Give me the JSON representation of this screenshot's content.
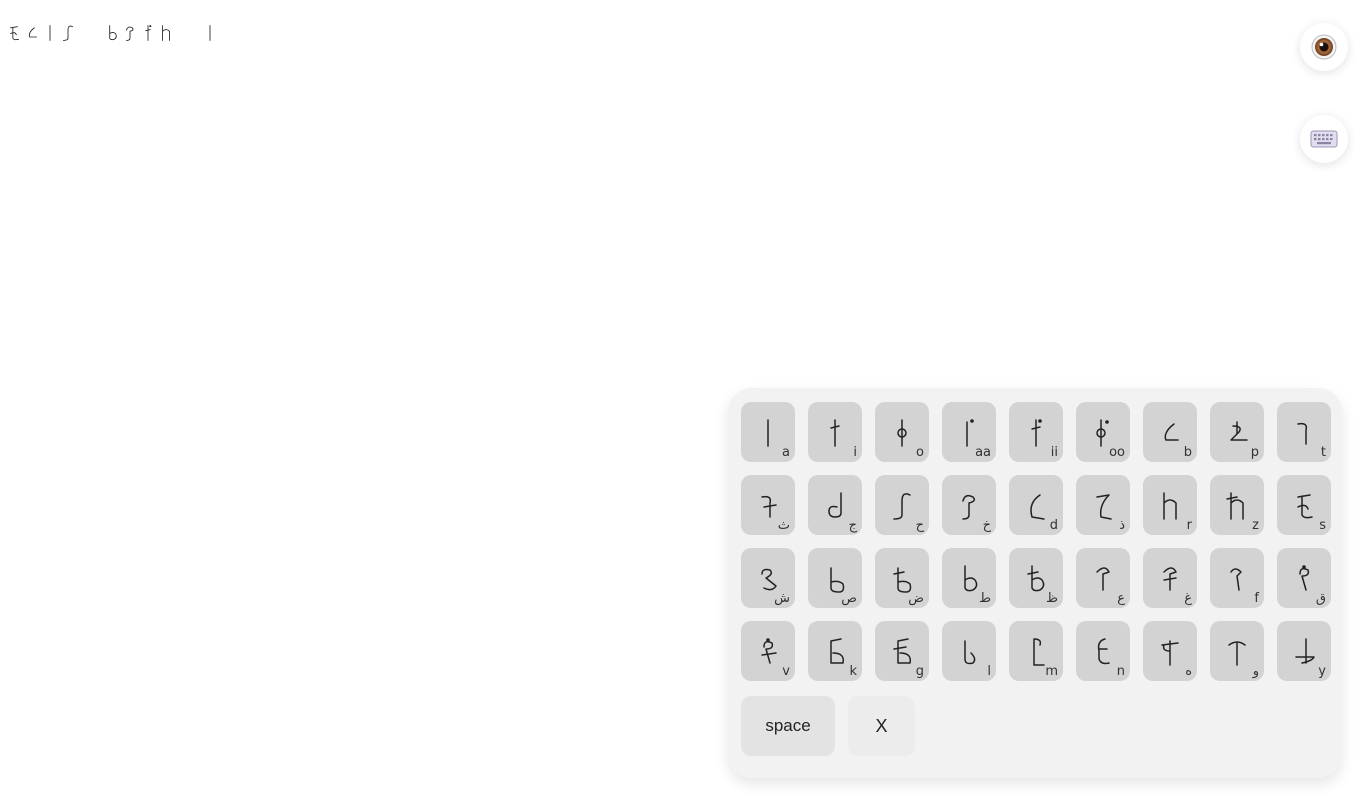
{
  "output": {
    "words": [
      {
        "glyphs": [
          "s",
          "b",
          "a",
          "ha"
        ]
      },
      {
        "glyphs": [
          "ta",
          "kha",
          "ii",
          "r"
        ]
      },
      {
        "glyphs": [
          "a"
        ]
      }
    ]
  },
  "buttons": {
    "eye_icon": "eye-icon",
    "keyboard_icon": "keyboard-icon"
  },
  "keyboard": {
    "space_label": "space",
    "close_label": "X",
    "keys": [
      {
        "id": "a",
        "hint": "a"
      },
      {
        "id": "i",
        "hint": "i"
      },
      {
        "id": "o",
        "hint": "o"
      },
      {
        "id": "aa",
        "hint": "aa"
      },
      {
        "id": "ii",
        "hint": "ii"
      },
      {
        "id": "oo",
        "hint": "oo"
      },
      {
        "id": "b",
        "hint": "b"
      },
      {
        "id": "p",
        "hint": "p"
      },
      {
        "id": "t",
        "hint": "t"
      },
      {
        "id": "tha",
        "hint": "ث"
      },
      {
        "id": "jim",
        "hint": "ج"
      },
      {
        "id": "ha",
        "hint": "ح"
      },
      {
        "id": "kha",
        "hint": "خ"
      },
      {
        "id": "d",
        "hint": "d"
      },
      {
        "id": "dhal",
        "hint": "ذ"
      },
      {
        "id": "r",
        "hint": "r"
      },
      {
        "id": "z",
        "hint": "z"
      },
      {
        "id": "s",
        "hint": "s"
      },
      {
        "id": "shin",
        "hint": "ش"
      },
      {
        "id": "sad",
        "hint": "ص"
      },
      {
        "id": "dad",
        "hint": "ض"
      },
      {
        "id": "ta",
        "hint": "ط"
      },
      {
        "id": "za",
        "hint": "ظ"
      },
      {
        "id": "ain",
        "hint": "ع"
      },
      {
        "id": "ghain",
        "hint": "غ"
      },
      {
        "id": "f",
        "hint": "f"
      },
      {
        "id": "qaf",
        "hint": "ق"
      },
      {
        "id": "v",
        "hint": "v"
      },
      {
        "id": "k",
        "hint": "k"
      },
      {
        "id": "g",
        "hint": "g"
      },
      {
        "id": "l",
        "hint": "l"
      },
      {
        "id": "m",
        "hint": "m"
      },
      {
        "id": "n",
        "hint": "n"
      },
      {
        "id": "heh",
        "hint": "ه"
      },
      {
        "id": "waw",
        "hint": "و"
      },
      {
        "id": "y",
        "hint": "y"
      }
    ]
  }
}
